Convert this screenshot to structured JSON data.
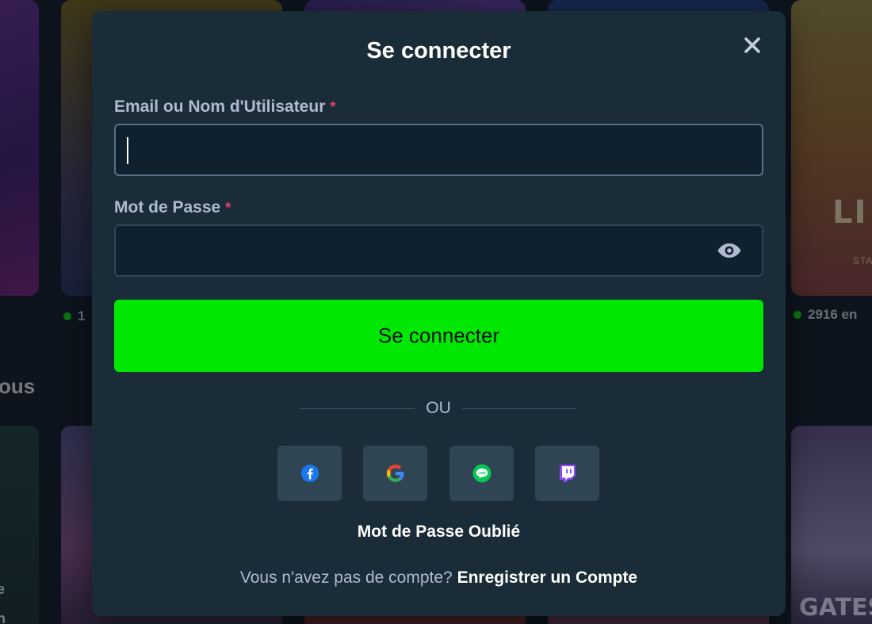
{
  "background": {
    "tile_right_label": "LI",
    "tile_right_sub": "STA",
    "online_left": "1",
    "online_right": "2916 en",
    "section_title": "ous",
    "bottom_right_label": "GATES",
    "left_text_1": "e",
    "left_text_2": "n"
  },
  "modal": {
    "title": "Se connecter",
    "close_icon": "close-icon",
    "email": {
      "label": "Email ou Nom d'Utilisateur",
      "required_mark": "*",
      "value": "",
      "placeholder": ""
    },
    "password": {
      "label": "Mot de Passe",
      "required_mark": "*",
      "value": "",
      "placeholder": "",
      "toggle_icon": "eye-icon"
    },
    "submit_label": "Se connecter",
    "divider_text": "OU",
    "social": [
      {
        "icon": "facebook-icon",
        "color": "#1877f2"
      },
      {
        "icon": "google-icon",
        "color": "#4285f4"
      },
      {
        "icon": "line-icon",
        "color": "#06c755"
      },
      {
        "icon": "twitch-icon",
        "color": "#9146ff"
      }
    ],
    "forgot_label": "Mot de Passe Oublié",
    "register_prompt": "Vous n'avez pas de compte?",
    "register_link": "Enregistrer un Compte"
  },
  "colors": {
    "accent": "#00e701",
    "modal_bg": "#1a2c38",
    "input_bg": "#0f212e",
    "required": "#ed4163"
  }
}
